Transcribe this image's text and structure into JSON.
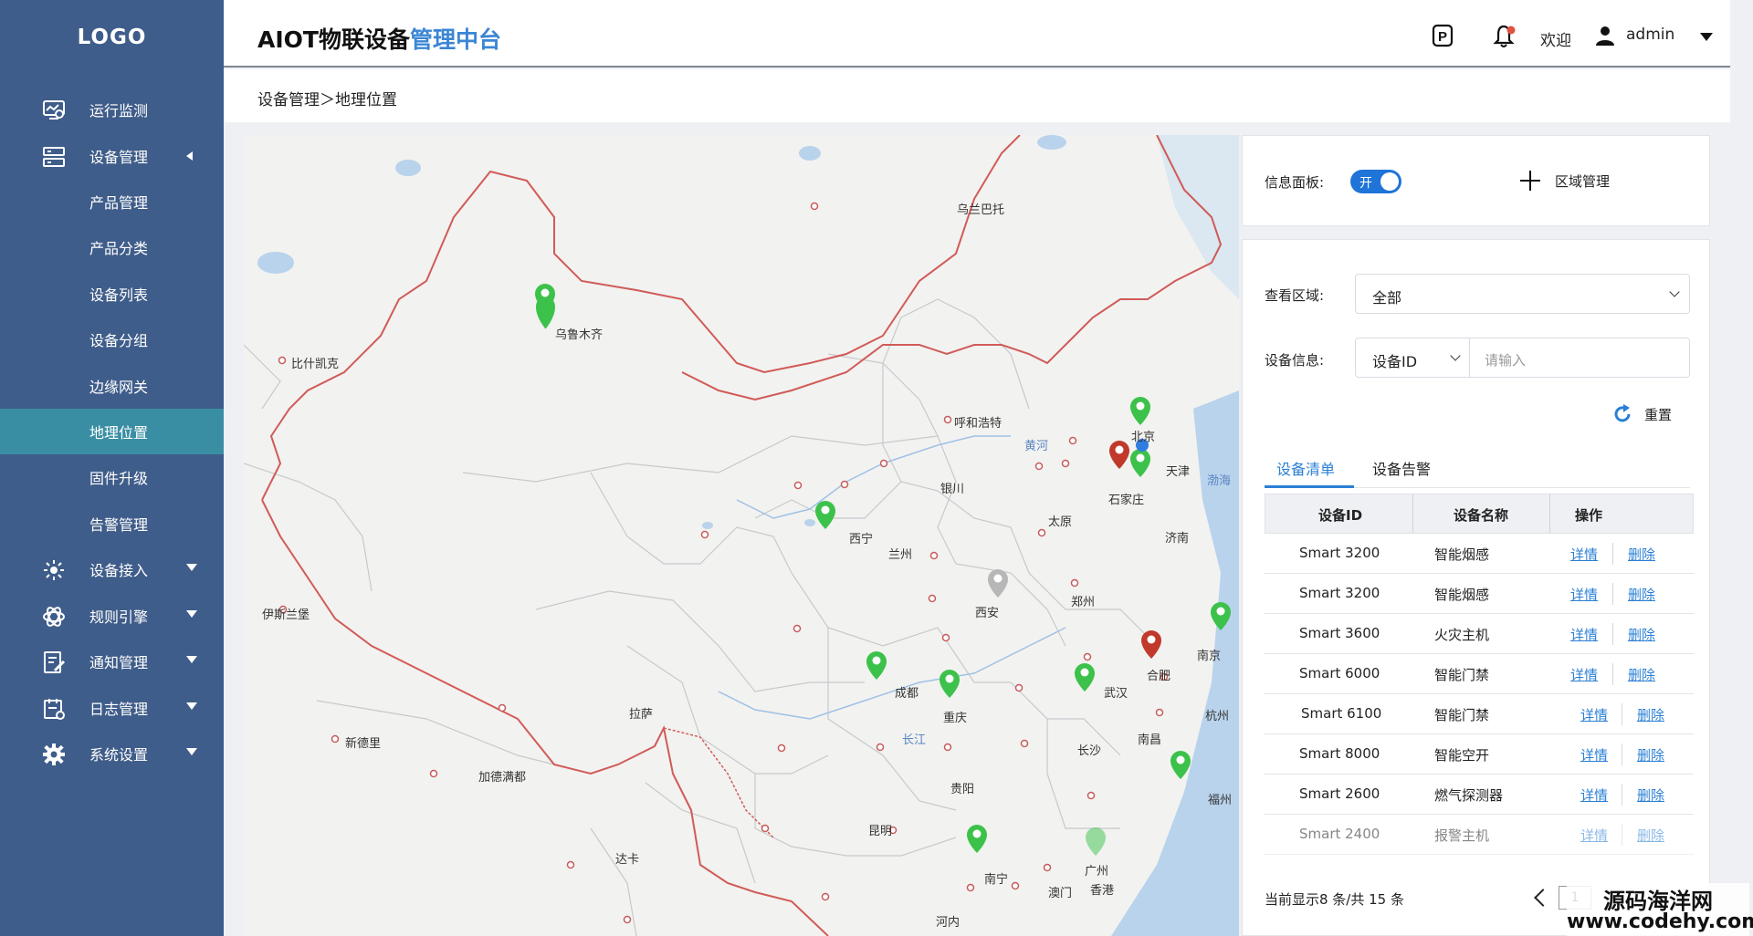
{
  "sidebar": {
    "logo": "LOGO",
    "items": [
      {
        "label": "运行监测"
      },
      {
        "label": "设备管理"
      },
      {
        "label": "产品管理"
      },
      {
        "label": "产品分类"
      },
      {
        "label": "设备列表"
      },
      {
        "label": "设备分组"
      },
      {
        "label": "边缘网关"
      },
      {
        "label": "地理位置"
      },
      {
        "label": "固件升级"
      },
      {
        "label": "告警管理"
      },
      {
        "label": "设备接入"
      },
      {
        "label": "规则引擎"
      },
      {
        "label": "通知管理"
      },
      {
        "label": "日志管理"
      },
      {
        "label": "系统设置"
      }
    ],
    "active_color": "#3a8ea3",
    "bg_color": "#3f5d8a"
  },
  "header": {
    "title_main": "AIOT物联设备",
    "title_accent": "管理中台",
    "accent_color": "#3b86d4",
    "welcome": "欢迎",
    "user": "admin",
    "parking_icon_letter": "P"
  },
  "breadcrumb": "设备管理＞地理位置",
  "map": {
    "cities": {
      "wlmq": "乌鲁木齐",
      "wlbt": "乌兰巴托",
      "bbkk": "比什凯克",
      "hhht": "呼和浩特",
      "bj": "北京",
      "tj": "天津",
      "sjz": "石家庄",
      "ty": "太原",
      "yc": "银川",
      "xn": "西宁",
      "lz": "兰州",
      "jn": "济南",
      "xa": "西安",
      "zz": "郑州",
      "ylb": "伊斯兰堡",
      "nj": "南京",
      "hf": "合肥",
      "cd": "成都",
      "cq": "重庆",
      "wh": "武汉",
      "hz": "杭州",
      "ls": "拉萨",
      "xdl": "新德里",
      "cs": "长沙",
      "nc": "南昌",
      "jdmd": "加德满都",
      "gy": "贵阳",
      "fz": "福州",
      "km": "昆明",
      "dk": "达卡",
      "nn": "南宁",
      "gz": "广州",
      "am": "澳门",
      "xg": "香港",
      "hn": "河内",
      "hh": "黄河",
      "cj": "长江",
      "bh": "渤海"
    }
  },
  "panel": {
    "info_panel_label": "信息面板:",
    "toggle_text": "开",
    "region_button": "区域管理",
    "view_region_label": "查看区域:",
    "view_region_value": "全部",
    "device_info_label": "设备信息:",
    "device_field_value": "设备ID",
    "device_input_placeholder": "请输入",
    "reset_button": "重置",
    "tabs": [
      "设备清单",
      "设备告警"
    ],
    "table": {
      "headers": [
        "设备ID",
        "设备名称",
        "操作"
      ],
      "rows": [
        {
          "id": "Smart 3200",
          "name": "智能烟感",
          "detail": "详情",
          "delete": "删除"
        },
        {
          "id": "Smart 3200",
          "name": "智能烟感",
          "detail": "详情",
          "delete": "删除"
        },
        {
          "id": "Smart 3600",
          "name": "火灾主机",
          "detail": "详情",
          "delete": "删除"
        },
        {
          "id": "Smart 6000",
          "name": "智能门禁",
          "detail": "详情",
          "delete": "删除"
        },
        {
          "id": "Smart 6100",
          "name": "智能门禁",
          "detail": "详情",
          "delete": "删除"
        },
        {
          "id": "Smart 8000",
          "name": "智能空开",
          "detail": "详情",
          "delete": "删除"
        },
        {
          "id": "Smart 2600",
          "name": "燃气探测器",
          "detail": "详情",
          "delete": "删除"
        },
        {
          "id": "Smart 2400",
          "name": "报警主机",
          "detail": "详情",
          "delete": "删除"
        }
      ]
    },
    "footer": "当前显示8 条/共 15 条",
    "page": "1"
  },
  "watermark": {
    "line1": "源码海洋网",
    "line2": "www.codehy.com"
  }
}
